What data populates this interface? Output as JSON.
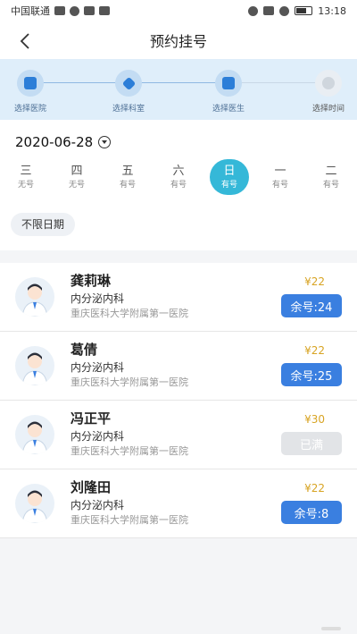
{
  "status_bar": {
    "carrier": "中国联通",
    "time": "13:18"
  },
  "header": {
    "title": "预约挂号"
  },
  "steps": [
    {
      "label": "选择医院",
      "active": true
    },
    {
      "label": "选择科室",
      "active": true
    },
    {
      "label": "选择医生",
      "active": true
    },
    {
      "label": "选择时间",
      "active": false
    }
  ],
  "date_picker": {
    "date": "2020-06-28"
  },
  "weekdays": [
    {
      "day": "三",
      "status": "无号",
      "selected": false
    },
    {
      "day": "四",
      "status": "无号",
      "selected": false
    },
    {
      "day": "五",
      "status": "有号",
      "selected": false
    },
    {
      "day": "六",
      "status": "有号",
      "selected": false
    },
    {
      "day": "日",
      "status": "有号",
      "selected": true
    },
    {
      "day": "一",
      "status": "有号",
      "selected": false
    },
    {
      "day": "二",
      "status": "有号",
      "selected": false
    }
  ],
  "filter": {
    "label": "不限日期"
  },
  "doctors": [
    {
      "name": "龚莉琳",
      "dept": "内分泌内科",
      "hospital": "重庆医科大学附属第一医院",
      "price": "¥22",
      "availability": "余号:24",
      "full": false
    },
    {
      "name": "葛倩",
      "dept": "内分泌内科",
      "hospital": "重庆医科大学附属第一医院",
      "price": "¥22",
      "availability": "余号:25",
      "full": false
    },
    {
      "name": "冯正平",
      "dept": "内分泌内科",
      "hospital": "重庆医科大学附属第一医院",
      "price": "¥30",
      "availability": "已满",
      "full": true
    },
    {
      "name": "刘隆田",
      "dept": "内分泌内科",
      "hospital": "重庆医科大学附属第一医院",
      "price": "¥22",
      "availability": "余号:8",
      "full": false
    }
  ],
  "colors": {
    "accent": "#3a7fe0",
    "selected_day": "#35b8d8",
    "price": "#d8a424",
    "steps_bg": "#dfeefa"
  }
}
